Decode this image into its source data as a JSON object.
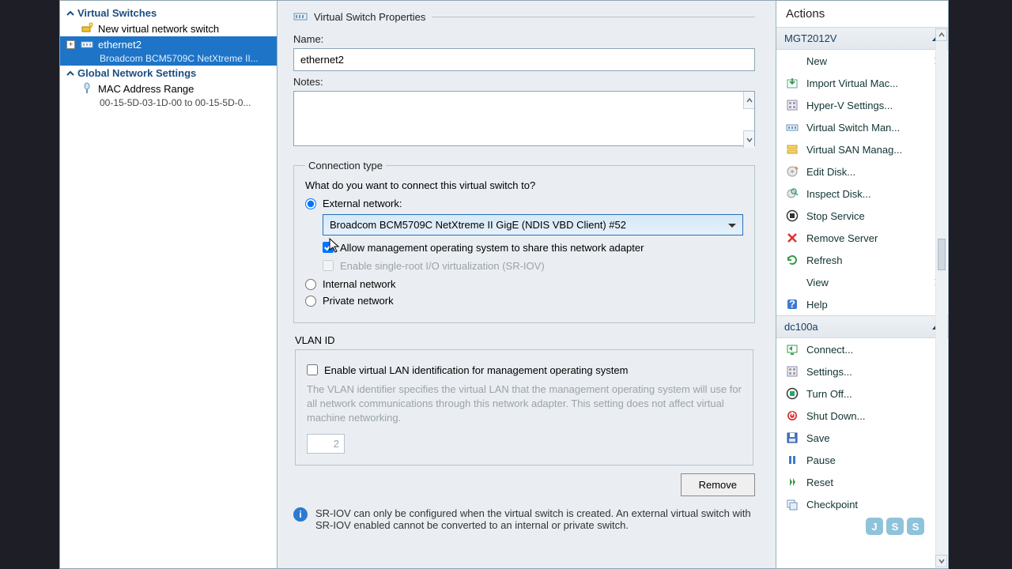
{
  "tree": {
    "virtual_switches_header": "Virtual Switches",
    "new_switch": "New virtual network switch",
    "selected_switch": "ethernet2",
    "selected_switch_sub": "Broadcom BCM5709C NetXtreme II...",
    "global_header": "Global Network Settings",
    "mac_range": "MAC Address Range",
    "mac_range_sub": "00-15-5D-03-1D-00 to 00-15-5D-0..."
  },
  "props": {
    "title": "Virtual Switch Properties",
    "name_label": "Name:",
    "name_value": "ethernet2",
    "notes_label": "Notes:",
    "notes_value": "",
    "conn_legend": "Connection type",
    "conn_question": "What do you want to connect this virtual switch to?",
    "external_label": "External network:",
    "adapter_selected": "Broadcom BCM5709C NetXtreme II GigE (NDIS VBD Client) #52",
    "allow_mgmt": "Allow management operating system to share this network adapter",
    "sriov": "Enable single-root I/O virtualization (SR-IOV)",
    "internal_label": "Internal network",
    "private_label": "Private network",
    "vlan_legend": "VLAN ID",
    "vlan_enable": "Enable virtual LAN identification for management operating system",
    "vlan_hint": "The VLAN identifier specifies the virtual LAN that the management operating system will use for all network communications through this network adapter. This setting does not affect virtual machine networking.",
    "vlan_value": "2",
    "remove_btn": "Remove",
    "sriov_info": "SR-IOV can only be configured when the virtual switch is created. An external virtual switch with SR-IOV enabled cannot be converted to an internal or private switch."
  },
  "actions": {
    "title": "Actions",
    "section1": "MGT2012V",
    "items1": [
      {
        "label": "New",
        "arrow": true,
        "icon": "blank"
      },
      {
        "label": "Import Virtual Mac...",
        "icon": "import"
      },
      {
        "label": "Hyper-V Settings...",
        "icon": "settings"
      },
      {
        "label": "Virtual Switch Man...",
        "icon": "vswitch"
      },
      {
        "label": "Virtual SAN Manag...",
        "icon": "san"
      },
      {
        "label": "Edit Disk...",
        "icon": "disk"
      },
      {
        "label": "Inspect Disk...",
        "icon": "inspect"
      },
      {
        "label": "Stop Service",
        "icon": "stop"
      },
      {
        "label": "Remove Server",
        "icon": "remove"
      },
      {
        "label": "Refresh",
        "icon": "refresh"
      },
      {
        "label": "View",
        "arrow": true,
        "icon": "blank"
      },
      {
        "label": "Help",
        "icon": "help"
      }
    ],
    "section2": "dc100a",
    "items2": [
      {
        "label": "Connect...",
        "icon": "connect"
      },
      {
        "label": "Settings...",
        "icon": "settings"
      },
      {
        "label": "Turn Off...",
        "icon": "turnoff"
      },
      {
        "label": "Shut Down...",
        "icon": "shutdown"
      },
      {
        "label": "Save",
        "icon": "save"
      },
      {
        "label": "Pause",
        "icon": "pause"
      },
      {
        "label": "Reset",
        "icon": "reset"
      },
      {
        "label": "Checkpoint",
        "icon": "checkpoint"
      }
    ]
  }
}
